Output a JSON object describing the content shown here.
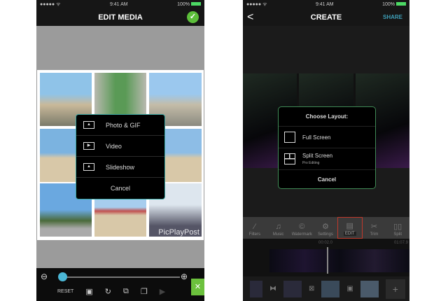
{
  "left": {
    "status": {
      "carrier": "●●●●● ᯤ",
      "time": "9:41 AM",
      "battery": "100%"
    },
    "title": "EDIT MEDIA",
    "confirm_icon": "✓",
    "watermark": "PicPlayPost",
    "menu": [
      {
        "label": "Photo & GIF",
        "icon": "photo-icon"
      },
      {
        "label": "Video",
        "icon": "video-icon"
      },
      {
        "label": "Slideshow",
        "icon": "slideshow-icon"
      },
      {
        "label": "Cancel"
      }
    ],
    "toolbar": {
      "reset": "RESET",
      "zoom_out": "⊖",
      "zoom_in": "⊕",
      "close": "✕",
      "zoom_level": 0
    }
  },
  "right": {
    "status": {
      "carrier": "●●●●● ᯤ",
      "time": "9:41 AM",
      "battery": "100%"
    },
    "title": "CREATE",
    "back": "<",
    "share": "SHARE",
    "dialog": {
      "title": "Choose Layout:",
      "options": [
        {
          "label": "Full Screen"
        },
        {
          "label": "Split Screen",
          "sub": "Pro Editing"
        }
      ],
      "cancel": "Cancel"
    },
    "tabs": [
      "Filters",
      "Music",
      "Watermark",
      "Settings",
      "EDIT",
      "Trim",
      "Split"
    ],
    "selected_tab": "EDIT",
    "time_start": "00:02.0",
    "time_end": "01:07.9",
    "add": "+"
  }
}
